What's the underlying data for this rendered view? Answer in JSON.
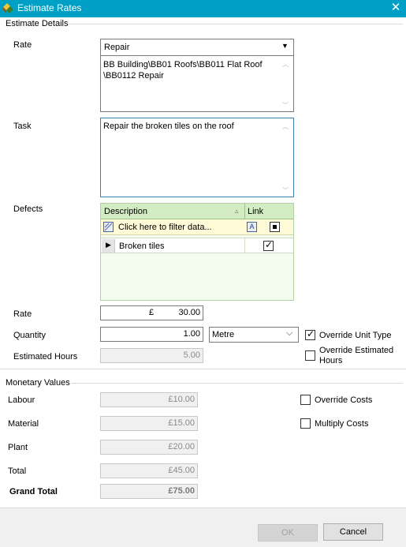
{
  "window": {
    "title": "Estimate Rates"
  },
  "estimate_details": {
    "group_label": "Estimate Details",
    "rate_label": "Rate",
    "rate_select_value": "Repair",
    "rate_path": "BB Building\\BB01 Roofs\\BB011 Flat Roof\n\\BB0112 Repair",
    "task_label": "Task",
    "task_value": "Repair the broken tiles on the roof",
    "defects_label": "Defects",
    "defects_grid": {
      "headers": {
        "description": "Description",
        "link": "Link"
      },
      "filter_text": "Click here to filter data...",
      "rows": [
        {
          "description": "Broken tiles",
          "link_checked": true
        }
      ]
    },
    "rate2_label": "Rate",
    "rate_currency": "£",
    "rate_value": "30.00",
    "quantity_label": "Quantity",
    "quantity_value": "1.00",
    "unit_value": "Metre",
    "override_unit_type_label": "Override Unit Type",
    "override_unit_type_checked": true,
    "estimated_hours_label": "Estimated Hours",
    "estimated_hours_value": "5.00",
    "override_estimated_hours_label_1": "Override Estimated",
    "override_estimated_hours_label_2": "Hours",
    "override_estimated_hours_checked": false
  },
  "monetary_values": {
    "group_label": "Monetary Values",
    "labour_label": "Labour",
    "labour_value": "£10.00",
    "material_label": "Material",
    "material_value": "£15.00",
    "plant_label": "Plant",
    "plant_value": "£20.00",
    "total_label": "Total",
    "total_value": "£45.00",
    "grand_total_label": "Grand Total",
    "grand_total_value": "£75.00",
    "override_costs_label": "Override Costs",
    "multiply_costs_label": "Multiply Costs"
  },
  "footer": {
    "ok_label": "OK",
    "cancel_label": "Cancel"
  },
  "colors": {
    "titlebar": "#00a0c6",
    "grid_header": "#d3ecc4",
    "grid_body": "#f4fbef"
  }
}
